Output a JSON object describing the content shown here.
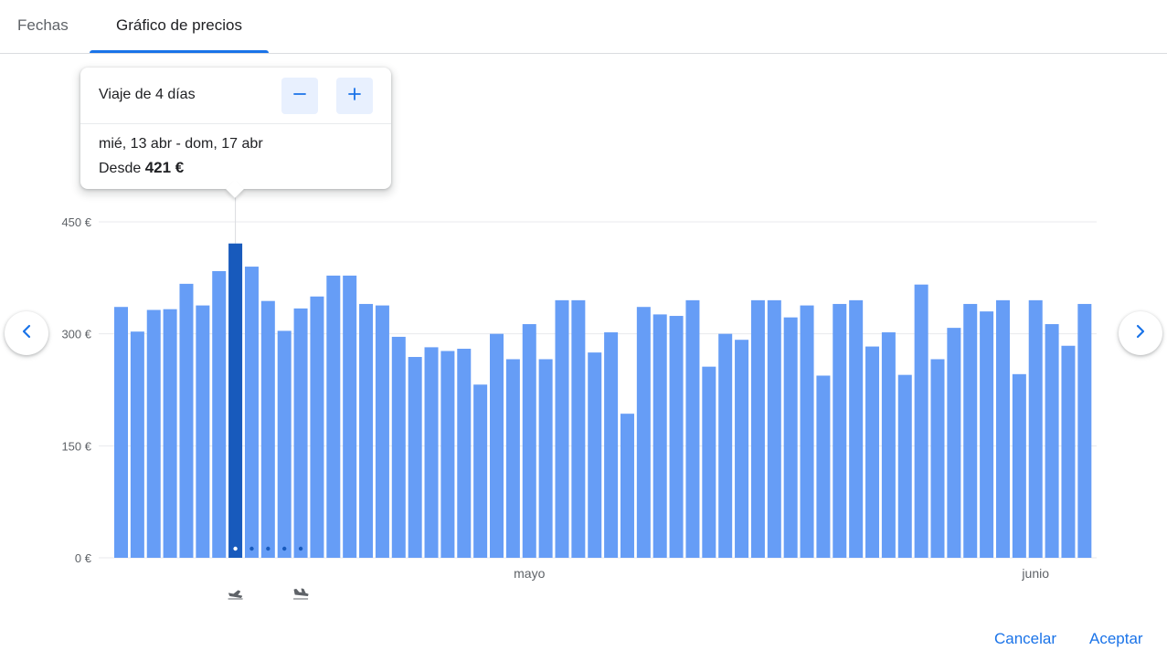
{
  "tabs": {
    "fechas": "Fechas",
    "grafico": "Gráfico de precios"
  },
  "tooltip": {
    "trip_label": "Viaje de 4 días",
    "dates": "mié, 13 abr - dom, 17 abr",
    "price_prefix": "Desde",
    "price": "421 €"
  },
  "actions": {
    "cancel": "Cancelar",
    "accept": "Aceptar"
  },
  "icons": {
    "prev": "chevron-left-icon",
    "next": "chevron-right-icon",
    "minus": "minus-icon",
    "plus": "plus-icon",
    "departure": "flight-takeoff-icon",
    "return": "flight-land-icon"
  },
  "colors": {
    "bar": "#669df6",
    "bar_selected": "#185abc",
    "accent": "#1a73e8",
    "grid": "#e8eaed"
  },
  "chart_data": {
    "type": "bar",
    "y_ticks": [
      "450 €",
      "300 €",
      "150 €",
      "0 €"
    ],
    "ylim": [
      0,
      450
    ],
    "month_labels": [
      {
        "label": "mayo",
        "index": 25
      },
      {
        "label": "junio",
        "index": 56
      }
    ],
    "selected_index": 7,
    "trip_span_days": 4,
    "values": [
      336,
      303,
      332,
      333,
      367,
      338,
      384,
      421,
      390,
      344,
      304,
      334,
      350,
      378,
      378,
      340,
      338,
      296,
      269,
      282,
      277,
      280,
      232,
      300,
      266,
      313,
      266,
      345,
      345,
      275,
      302,
      193,
      336,
      326,
      324,
      345,
      256,
      300,
      292,
      345,
      345,
      322,
      338,
      244,
      340,
      345,
      283,
      302,
      245,
      366,
      266,
      308,
      340,
      330,
      345,
      246,
      345,
      313,
      284,
      340
    ]
  }
}
